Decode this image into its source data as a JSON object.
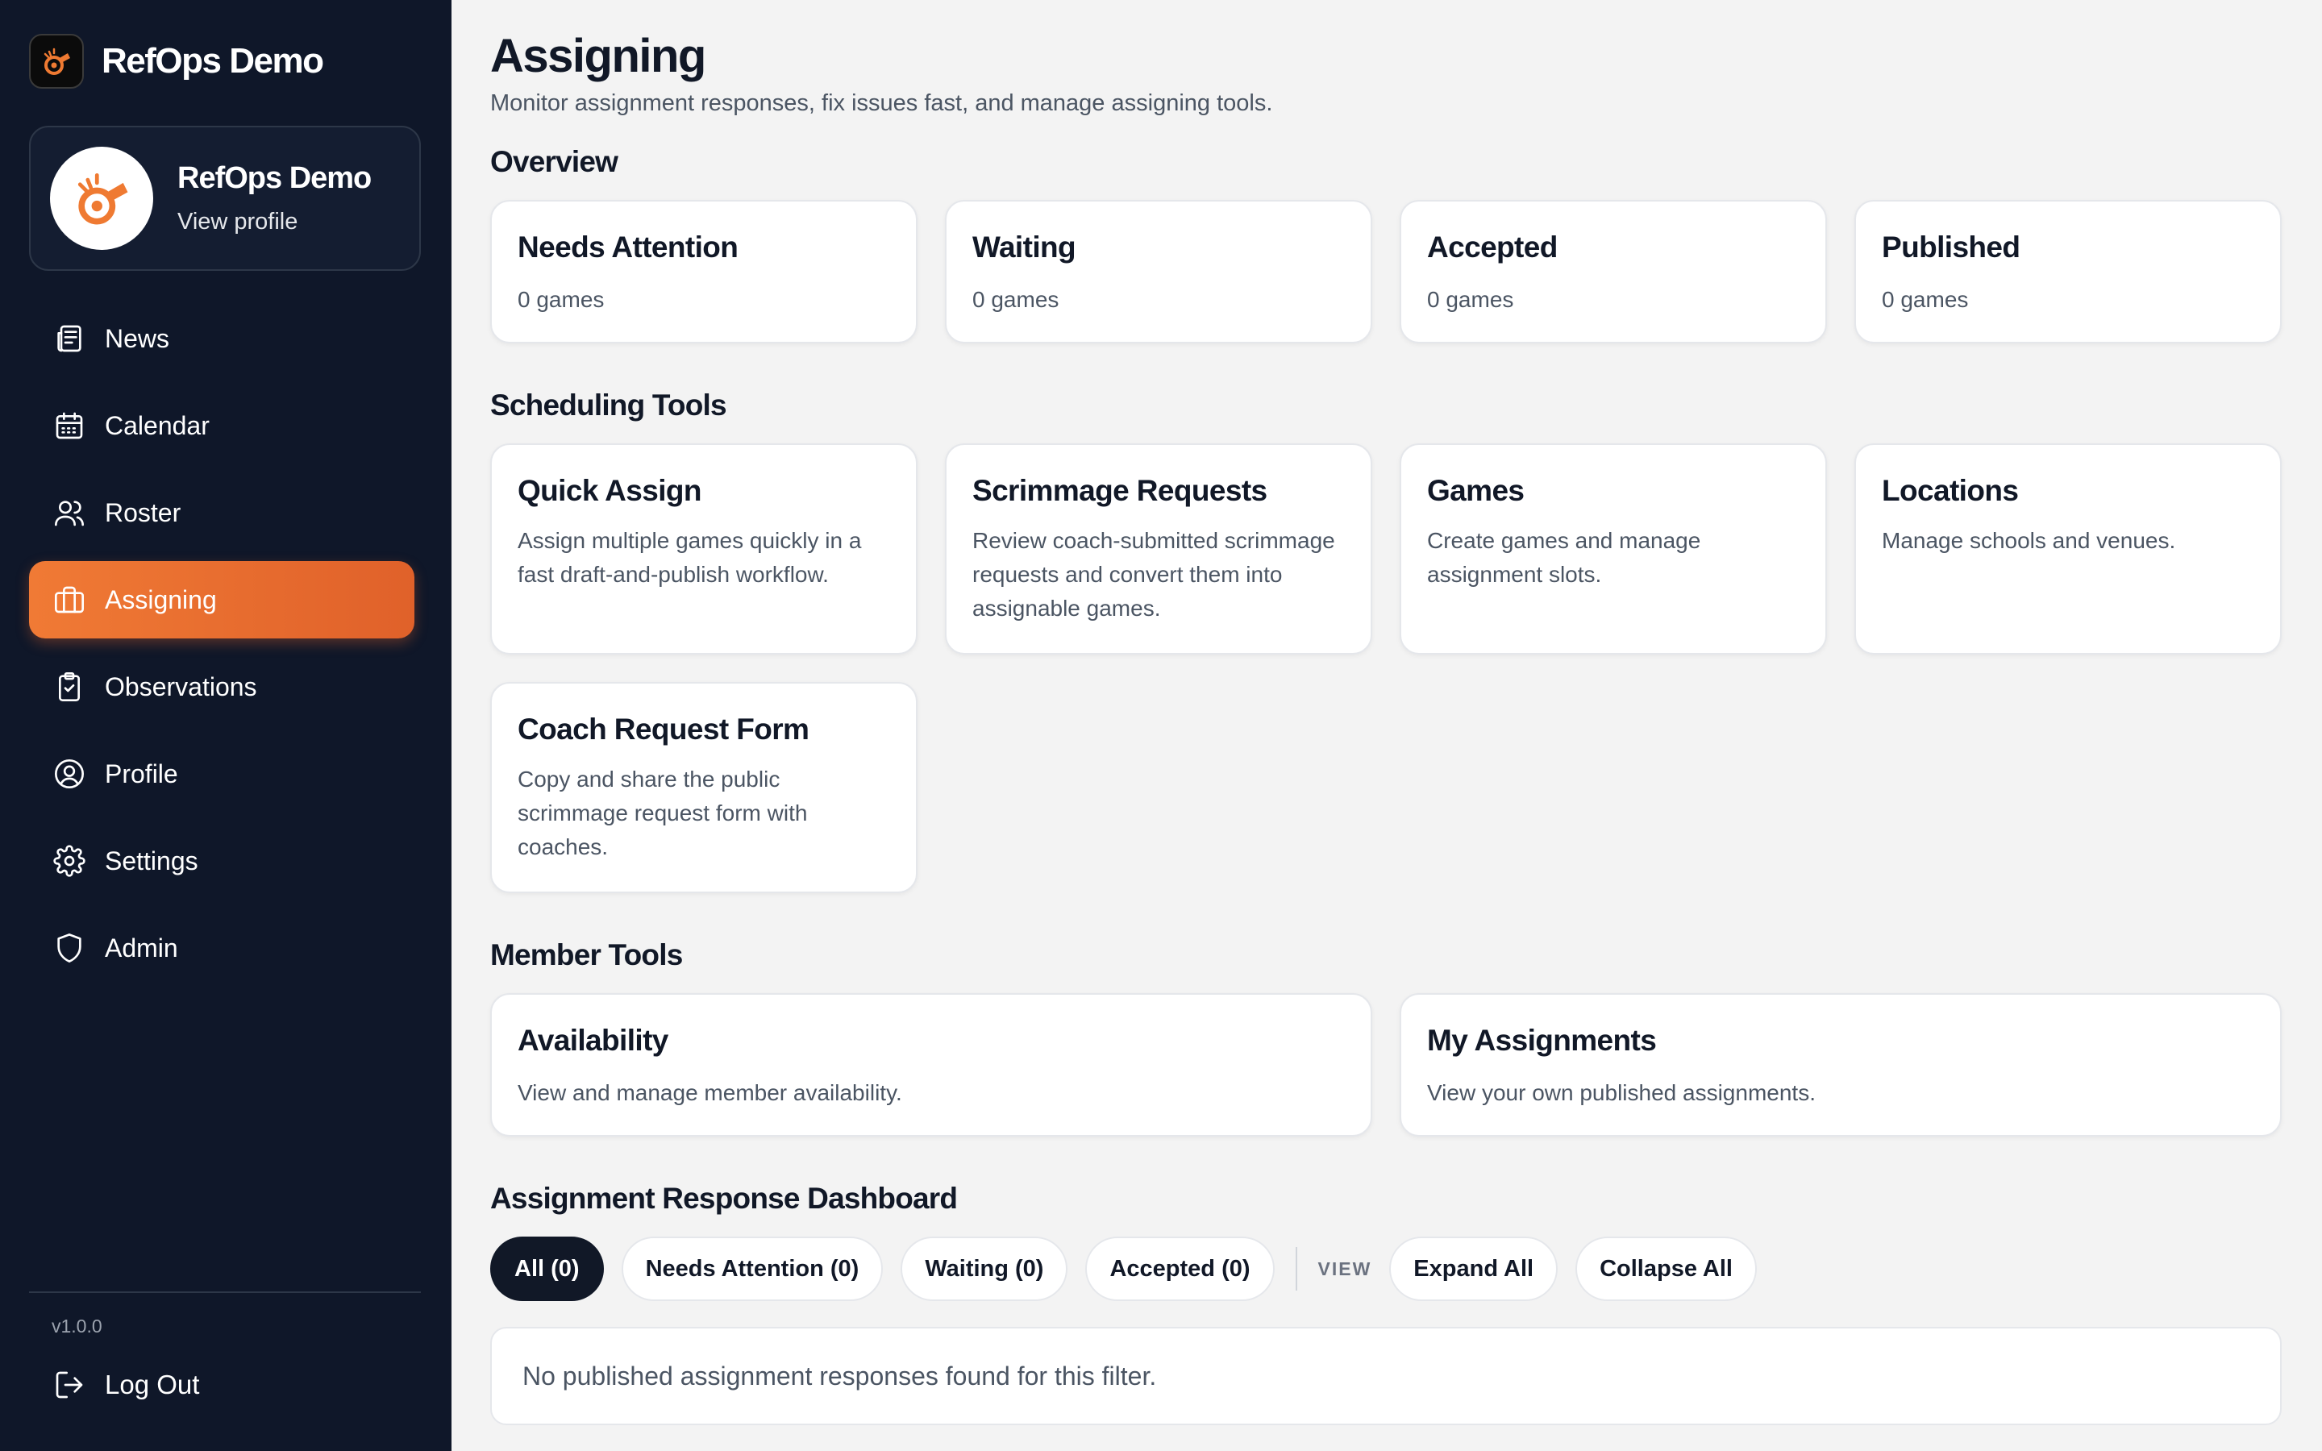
{
  "app": {
    "name": "RefOps Demo",
    "accent_color": "#e96a2e",
    "sidebar_bg": "#0f1729"
  },
  "profile": {
    "name": "RefOps Demo",
    "link": "View profile",
    "avatar_icon": "whistle-icon"
  },
  "nav": {
    "items": [
      {
        "label": "News",
        "icon": "newspaper-icon",
        "active": false
      },
      {
        "label": "Calendar",
        "icon": "calendar-icon",
        "active": false
      },
      {
        "label": "Roster",
        "icon": "users-icon",
        "active": false
      },
      {
        "label": "Assigning",
        "icon": "briefcase-icon",
        "active": true
      },
      {
        "label": "Observations",
        "icon": "clipboard-check-icon",
        "active": false
      },
      {
        "label": "Profile",
        "icon": "user-circle-icon",
        "active": false
      },
      {
        "label": "Settings",
        "icon": "gear-icon",
        "active": false
      },
      {
        "label": "Admin",
        "icon": "shield-icon",
        "active": false
      }
    ]
  },
  "footer": {
    "version": "v1.0.0",
    "logout": "Log Out"
  },
  "page": {
    "title": "Assigning",
    "subtitle": "Monitor assignment responses, fix issues fast, and manage assigning tools."
  },
  "overview": {
    "title": "Overview",
    "cards": [
      {
        "title": "Needs Attention",
        "count": "0 games"
      },
      {
        "title": "Waiting",
        "count": "0 games"
      },
      {
        "title": "Accepted",
        "count": "0 games"
      },
      {
        "title": "Published",
        "count": "0 games"
      }
    ]
  },
  "scheduling": {
    "title": "Scheduling Tools",
    "cards": [
      {
        "title": "Quick Assign",
        "desc": "Assign multiple games quickly in a fast draft-and-publish workflow."
      },
      {
        "title": "Scrimmage Requests",
        "desc": "Review coach-submitted scrimmage requests and convert them into assignable games."
      },
      {
        "title": "Games",
        "desc": "Create games and manage assignment slots."
      },
      {
        "title": "Locations",
        "desc": "Manage schools and venues."
      },
      {
        "title": "Coach Request Form",
        "desc": "Copy and share the public scrimmage request form with coaches."
      }
    ]
  },
  "member": {
    "title": "Member Tools",
    "cards": [
      {
        "title": "Availability",
        "desc": "View and manage member availability."
      },
      {
        "title": "My Assignments",
        "desc": "View your own published assignments."
      }
    ]
  },
  "dashboard": {
    "title": "Assignment Response Dashboard",
    "filters": [
      "All (0)",
      "Needs Attention (0)",
      "Waiting (0)",
      "Accepted (0)"
    ],
    "active_filter": "All (0)",
    "view_label": "VIEW",
    "expand_all": "Expand All",
    "collapse_all": "Collapse All",
    "empty_message": "No published assignment responses found for this filter."
  }
}
